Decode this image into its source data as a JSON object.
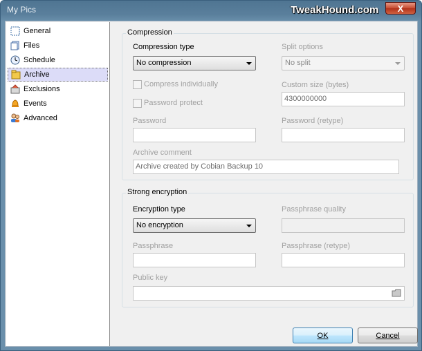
{
  "window": {
    "title": "My Pics",
    "watermark": "TweakHound.com",
    "close_glyph": "X"
  },
  "nav": {
    "items": [
      {
        "label": "General",
        "icon": "general-icon"
      },
      {
        "label": "Files",
        "icon": "files-icon"
      },
      {
        "label": "Schedule",
        "icon": "schedule-icon"
      },
      {
        "label": "Archive",
        "icon": "archive-icon",
        "selected": true
      },
      {
        "label": "Exclusions",
        "icon": "exclusions-icon"
      },
      {
        "label": "Events",
        "icon": "events-icon"
      },
      {
        "label": "Advanced",
        "icon": "advanced-icon"
      }
    ]
  },
  "compression": {
    "group_title": "Compression",
    "type_label": "Compression type",
    "type_value": "No compression",
    "split_label": "Split options",
    "split_value": "No split",
    "compress_individually": "Compress individually",
    "custom_size_label": "Custom size (bytes)",
    "custom_size_value": "4300000000",
    "password_protect": "Password protect",
    "password_label": "Password",
    "password_retype_label": "Password (retype)",
    "comment_label": "Archive comment",
    "comment_value": "Archive created by Cobian Backup 10"
  },
  "encryption": {
    "group_title": "Strong encryption",
    "type_label": "Encryption type",
    "type_value": "No encryption",
    "quality_label": "Passphrase quality",
    "passphrase_label": "Passphrase",
    "passphrase_retype_label": "Passphrase (retype)",
    "public_key_label": "Public key"
  },
  "buttons": {
    "ok": "OK",
    "cancel": "Cancel"
  },
  "colors": {
    "selection": "#dcdcf8",
    "title_bar": "#5a7f9c",
    "close_button": "#c64a2f"
  }
}
